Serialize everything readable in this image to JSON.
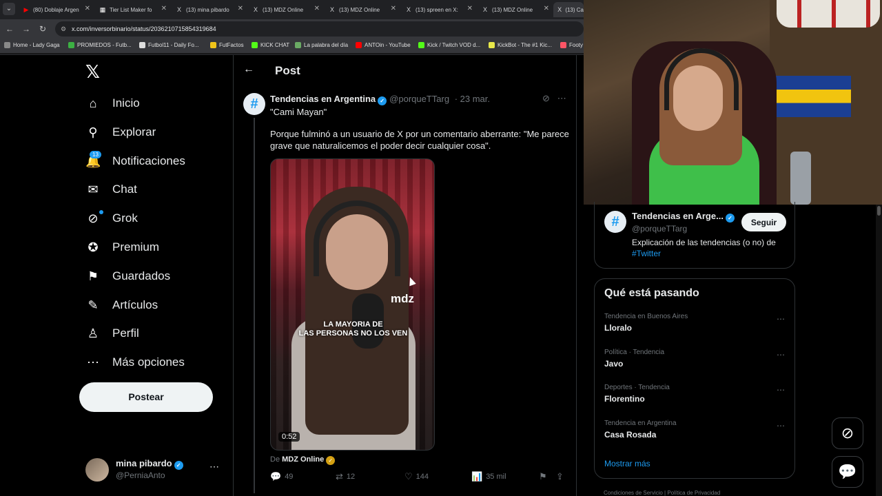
{
  "browser": {
    "tabs": [
      {
        "label": "(80) Doblaje Argen",
        "icon": "youtube-icon"
      },
      {
        "label": "Tier List Maker fo",
        "icon": "tier-icon"
      },
      {
        "label": "(13) mina pibardo",
        "icon": "x-icon"
      },
      {
        "label": "(13) MDZ Online",
        "icon": "x-icon"
      },
      {
        "label": "(13) MDZ Online",
        "icon": "x-icon"
      },
      {
        "label": "(13) spreen en X:",
        "icon": "x-icon"
      },
      {
        "label": "(13) MDZ Online",
        "icon": "x-icon"
      },
      {
        "label": "(13) Ca",
        "icon": "x-icon"
      }
    ],
    "url": "x.com/inversorbinario/status/2036210715854319684",
    "bookmarks": [
      {
        "label": "Home - Lady Gaga",
        "color": "#888888"
      },
      {
        "label": "PROMIEDOS - Futb...",
        "color": "#3cb043"
      },
      {
        "label": "Futbol11 - Daily Fo...",
        "color": "#dddddd"
      },
      {
        "label": "FutFactos",
        "color": "#f0c419"
      },
      {
        "label": "KICK CHAT",
        "color": "#53fc18"
      },
      {
        "label": "La palabra del día",
        "color": "#6aaa64"
      },
      {
        "label": "ANTOin - YouTube",
        "color": "#ff0000"
      },
      {
        "label": "Kick / Twitch VOD d...",
        "color": "#53fc18"
      },
      {
        "label": "KickBot - The #1 Kic...",
        "color": "#e8e84a"
      },
      {
        "label": "Footy",
        "color": "#ff5566"
      }
    ]
  },
  "nav": {
    "items": [
      {
        "label": "Inicio",
        "icon": "home-icon",
        "glyph": "⌂"
      },
      {
        "label": "Explorar",
        "icon": "search-icon",
        "glyph": "⚲"
      },
      {
        "label": "Notificaciones",
        "icon": "bell-icon",
        "glyph": "🔔"
      },
      {
        "label": "Chat",
        "icon": "mail-icon",
        "glyph": "✉"
      },
      {
        "label": "Grok",
        "icon": "grok-icon",
        "glyph": "⊘"
      },
      {
        "label": "Premium",
        "icon": "premium-icon",
        "glyph": "✪"
      },
      {
        "label": "Guardados",
        "icon": "bookmark-icon",
        "glyph": "⚑"
      },
      {
        "label": "Artículos",
        "icon": "articles-icon",
        "glyph": "✎"
      },
      {
        "label": "Perfil",
        "icon": "profile-icon",
        "glyph": "♙"
      },
      {
        "label": "Más opciones",
        "icon": "more-icon",
        "glyph": "⋯"
      }
    ],
    "notifications_badge": "13",
    "post_button": "Postear",
    "user": {
      "name": "mina pibardo",
      "handle": "@PerniaAnto"
    }
  },
  "main": {
    "title": "Post",
    "tweet": {
      "author": "Tendencias en Argentina",
      "handle": "@porqueTTarg",
      "date": "· 23 mar.",
      "quote": "\"Cami Mayan\"",
      "text": "Porque fulminó a un usuario de X por un comentario aberrante: \"Me parece grave que naturalicemos el poder decir cualquier cosa\".",
      "media": {
        "logo": "mdz",
        "caption_line1": "LA MAYORIA DE",
        "caption_line2": "LAS PERSONAS NO LOS VEN",
        "duration": "0:52"
      },
      "source_prefix": "De",
      "source_name": "MDZ Online",
      "stats": {
        "replies": "49",
        "retweets": "12",
        "likes": "144",
        "views": "35 mil"
      }
    }
  },
  "sidebar": {
    "profile_card": {
      "name": "Tendencias en Arge...",
      "handle": "@porqueTTarg",
      "follow": "Seguir",
      "bio": "Explicación de las tendencias (o no) de",
      "hashtag": "#Twitter"
    },
    "trends": {
      "title": "Qué está pasando",
      "items": [
        {
          "context": "Tendencia en Buenos Aires",
          "name": "Lloralo"
        },
        {
          "context": "Política · Tendencia",
          "name": "Javo"
        },
        {
          "context": "Deportes · Tendencia",
          "name": "Florentino"
        },
        {
          "context": "Tendencia en Argentina",
          "name": "Casa Rosada"
        }
      ],
      "show_more": "Mostrar más"
    },
    "footer": "Condiciones de Servicio  |  Política de Privacidad"
  },
  "colors": {
    "accent": "#1d9bf0",
    "background": "#000000",
    "muted": "#71767b"
  }
}
